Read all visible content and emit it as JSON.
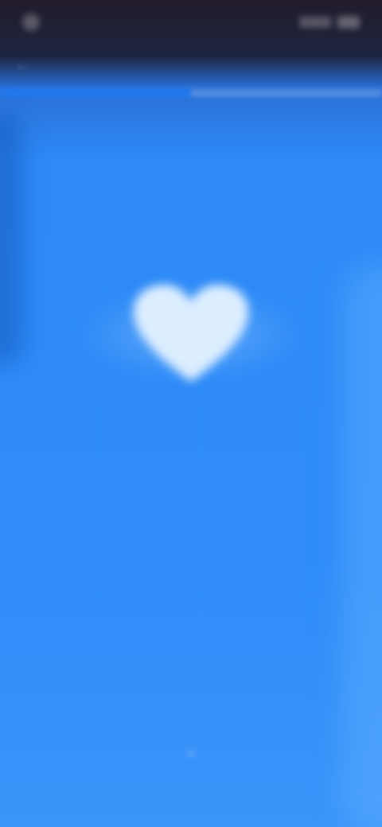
{
  "status_bar": {
    "time": "",
    "left_icon": "app-icon",
    "signal_icon": "signal-icon",
    "battery_icon": "battery-icon"
  },
  "nav": {
    "back_icon": "back-arrow-icon"
  },
  "progress": {
    "value": 0.5
  },
  "content": {
    "title_line1": "",
    "title_line2": "",
    "heart_icon": "heart-icon",
    "heart_label": ""
  },
  "footer": {
    "text": "",
    "icon": "chevron-down-icon"
  },
  "colors": {
    "background": "#2f8cf8",
    "heart": "#dceeff",
    "status_bar": "#1c1a2a"
  }
}
